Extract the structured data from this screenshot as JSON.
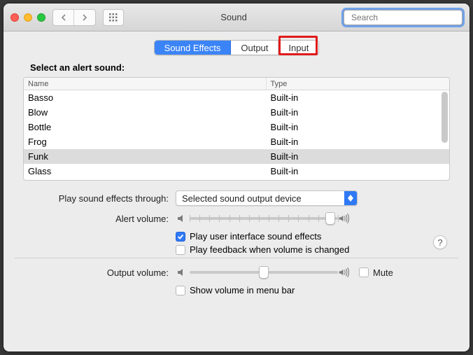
{
  "titlebar": {
    "title": "Sound",
    "search_placeholder": "Search"
  },
  "tabs": {
    "items": [
      "Sound Effects",
      "Output",
      "Input"
    ],
    "active_index": 0,
    "highlight_index": 2
  },
  "section": {
    "heading": "Select an alert sound:",
    "columns": {
      "name": "Name",
      "type": "Type"
    },
    "rows": [
      {
        "name": "Basso",
        "type": "Built-in",
        "selected": false
      },
      {
        "name": "Blow",
        "type": "Built-in",
        "selected": false
      },
      {
        "name": "Bottle",
        "type": "Built-in",
        "selected": false
      },
      {
        "name": "Frog",
        "type": "Built-in",
        "selected": false
      },
      {
        "name": "Funk",
        "type": "Built-in",
        "selected": true
      },
      {
        "name": "Glass",
        "type": "Built-in",
        "selected": false
      }
    ]
  },
  "play_through": {
    "label": "Play sound effects through:",
    "value": "Selected sound output device"
  },
  "alert_volume": {
    "label": "Alert volume:",
    "percent": 95
  },
  "checks": {
    "ui_sounds_label": "Play user interface sound effects",
    "ui_sounds_checked": true,
    "feedback_label": "Play feedback when volume is changed",
    "feedback_checked": false
  },
  "output_volume": {
    "label": "Output volume:",
    "percent": 50,
    "mute_label": "Mute",
    "mute_checked": false
  },
  "menubar": {
    "label": "Show volume in menu bar",
    "checked": false
  },
  "help_label": "?"
}
